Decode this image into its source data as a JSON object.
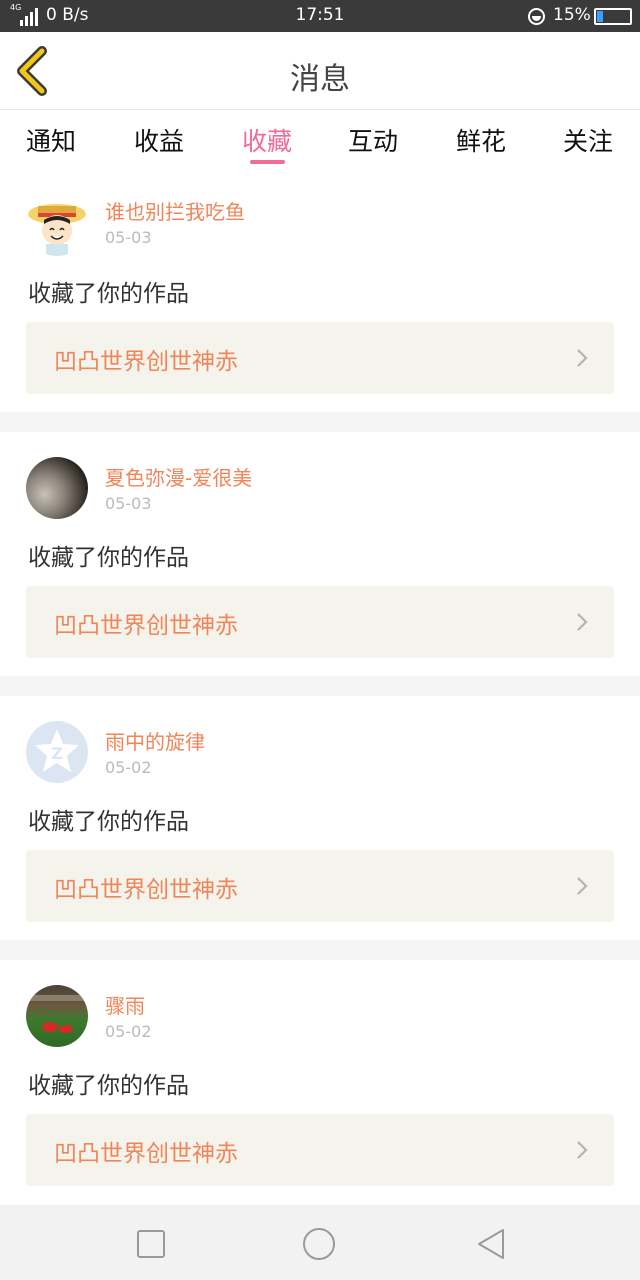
{
  "status_bar": {
    "network": "4G",
    "speed": "0 B/s",
    "time": "17:51",
    "battery": "15%"
  },
  "header": {
    "title": "消息"
  },
  "tabs": [
    {
      "label": "通知"
    },
    {
      "label": "收益"
    },
    {
      "label": "收藏",
      "active": true
    },
    {
      "label": "互动"
    },
    {
      "label": "鲜花"
    },
    {
      "label": "关注"
    }
  ],
  "notifications": [
    {
      "username": "谁也别拦我吃鱼",
      "date": "05-03",
      "action": "收藏了你的作品",
      "work": "凹凸世界创世神赤",
      "avatar": "anime-avatar"
    },
    {
      "username": "夏色弥漫-爱很美",
      "date": "05-03",
      "action": "收藏了你的作品",
      "work": "凹凸世界创世神赤",
      "avatar": "photo-avatar"
    },
    {
      "username": "雨中的旋律",
      "date": "05-02",
      "action": "收藏了你的作品",
      "work": "凹凸世界创世神赤",
      "avatar": "default-z-avatar"
    },
    {
      "username": "骤雨",
      "date": "05-02",
      "action": "收藏了你的作品",
      "work": "凹凸世界创世神赤",
      "avatar": "photo-avatar"
    }
  ],
  "colors": {
    "accent": "#f06a9a",
    "username": "#f0855a",
    "back_icon": "#f5c518"
  },
  "icons": [
    "back-chevron-icon",
    "chevron-right-icon",
    "nav-square-icon",
    "nav-circle-icon",
    "nav-triangle-icon"
  ]
}
